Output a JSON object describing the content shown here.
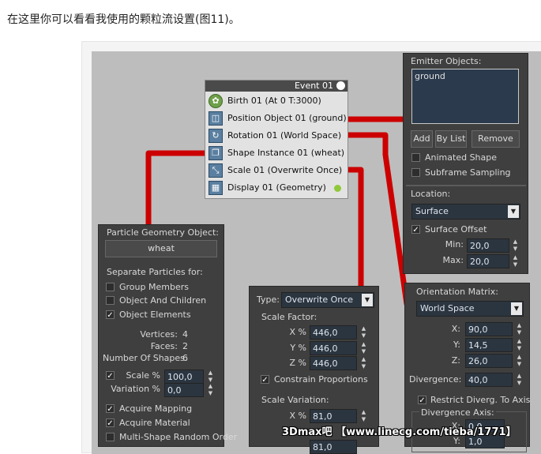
{
  "caption": "在这里你可以看看我使用的颗粒流设置(图11)。",
  "event": {
    "title": "Event 01",
    "operators": [
      {
        "label": "Birth 01 (At 0 T:3000)",
        "icon": "birth-icon"
      },
      {
        "label": "Position Object 01 (ground)",
        "icon": "position-object-icon"
      },
      {
        "label": "Rotation 01 (World Space)",
        "icon": "rotation-icon"
      },
      {
        "label": "Shape Instance 01 (wheat)",
        "icon": "shape-instance-icon"
      },
      {
        "label": "Scale 01 (Overwrite Once)",
        "icon": "scale-icon"
      },
      {
        "label": "Display 01 (Geometry)",
        "icon": "display-icon"
      }
    ]
  },
  "emitter": {
    "title": "Emitter Objects:",
    "items": [
      "ground"
    ],
    "add": "Add",
    "by_list": "By List",
    "remove": "Remove",
    "animated_shape": "Animated Shape",
    "subframe_sampling": "Subframe Sampling",
    "location_title": "Location:",
    "location_value": "Surface",
    "surface_offset": "Surface Offset",
    "min_label": "Min:",
    "min_value": "20,0",
    "max_label": "Max:",
    "max_value": "20,0"
  },
  "particle_geometry": {
    "title": "Particle Geometry Object:",
    "object_button": "wheat",
    "separate_title": "Separate Particles for:",
    "group_members": "Group Members",
    "object_children": "Object And Children",
    "object_elements": "Object Elements",
    "vertices_label": "Vertices:",
    "vertices_value": "4",
    "faces_label": "Faces:",
    "faces_value": "2",
    "shapes_label": "Number Of Shapes:",
    "shapes_value": "6",
    "scale_label": "Scale %",
    "scale_value": "100,0",
    "variation_label": "Variation %",
    "variation_value": "0,0",
    "acquire_mapping": "Acquire Mapping",
    "acquire_material": "Acquire Material",
    "multi_shape": "Multi-Shape Random Order"
  },
  "scale": {
    "type_label": "Type:",
    "type_value": "Overwrite Once",
    "factor_title": "Scale Factor:",
    "x_label": "X %",
    "x_value": "446,0",
    "y_label": "Y %",
    "y_value": "446,0",
    "z_label": "Z %",
    "z_value": "446,0",
    "constrain": "Constrain Proportions",
    "variation_title": "Scale Variation:",
    "vx_label": "X %",
    "vx_value": "81,0",
    "vz_value": "81,0"
  },
  "orientation": {
    "title": "Orientation Matrix:",
    "value": "World Space",
    "x_label": "X:",
    "x_value": "90,0",
    "y_label": "Y:",
    "y_value": "14,5",
    "z_label": "Z:",
    "z_value": "26,0",
    "divergence_label": "Divergence:",
    "divergence_value": "40,0",
    "restrict": "Restrict Diverg. To Axis",
    "axis_title": "Divergence Axis:",
    "ax_label": "X:",
    "ax_value": "0,0",
    "ay_label": "Y:",
    "ay_value": "1,0"
  },
  "watermark": "3Dmax吧 【www.linecg.com/tieba/1771】",
  "colors": {
    "wire": "#cc0000",
    "panel": "#3f3f3f",
    "field": "#2b3540"
  }
}
